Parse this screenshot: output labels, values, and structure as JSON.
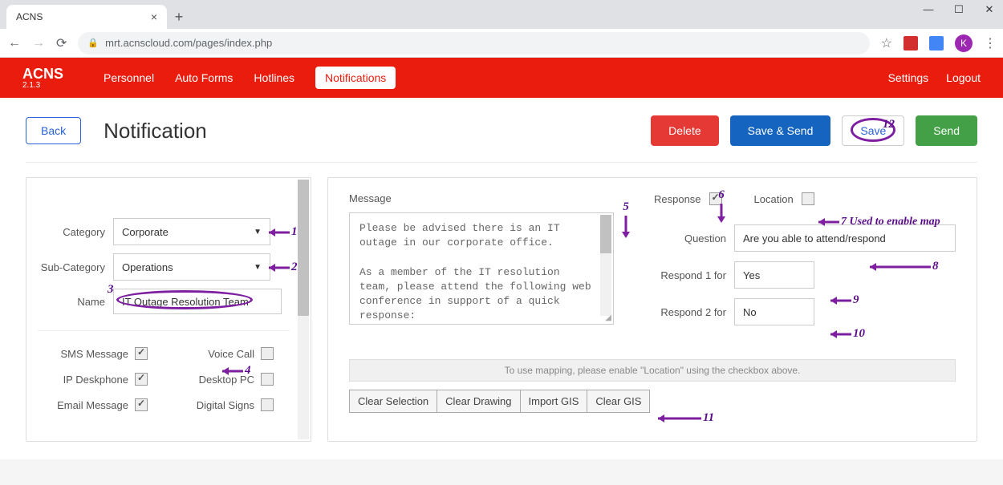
{
  "browser": {
    "tab_title": "ACNS",
    "url": "mrt.acnscloud.com/pages/index.php",
    "avatar_letter": "K"
  },
  "header": {
    "brand": "ACNS",
    "version": "2.1.3",
    "menu": [
      "Personnel",
      "Auto Forms",
      "Hotlines",
      "Notifications"
    ],
    "right": [
      "Settings",
      "Logout"
    ]
  },
  "page": {
    "back": "Back",
    "title": "Notification",
    "buttons": {
      "delete": "Delete",
      "save_send": "Save & Send",
      "save": "Save",
      "send": "Send"
    }
  },
  "form": {
    "category_label": "Category",
    "category_value": "Corporate",
    "subcategory_label": "Sub-Category",
    "subcategory_value": "Operations",
    "name_label": "Name",
    "name_value": "IT Outage Resolution Team"
  },
  "channels": {
    "sms": "SMS Message",
    "voice": "Voice Call",
    "ipdesk": "IP Deskphone",
    "desktop": "Desktop PC",
    "email": "Email Message",
    "digital": "Digital Signs"
  },
  "message": {
    "label": "Message",
    "body": "Please be advised there is an IT outage in our corporate office.\n\nAs a member of the IT resolution team, please attend the following web conference in support of a quick response:"
  },
  "response": {
    "response_label": "Response",
    "location_label": "Location",
    "question_label": "Question",
    "question_value": "Are you able to attend/respond",
    "r1_label": "Respond 1 for",
    "r1_value": "Yes",
    "r2_label": "Respond 2 for",
    "r2_value": "No"
  },
  "map": {
    "notice": "To use mapping, please enable \"Location\" using the checkbox above.",
    "buttons": [
      "Clear Selection",
      "Clear Drawing",
      "Import GIS",
      "Clear GIS"
    ]
  },
  "annotations": {
    "n1": "1",
    "n2": "2",
    "n3": "3",
    "n4": "4",
    "n5": "5",
    "n6": "6",
    "n7": "7 Used to enable map",
    "n8": "8",
    "n9": "9",
    "n10": "10",
    "n11": "11",
    "n12": "12"
  }
}
